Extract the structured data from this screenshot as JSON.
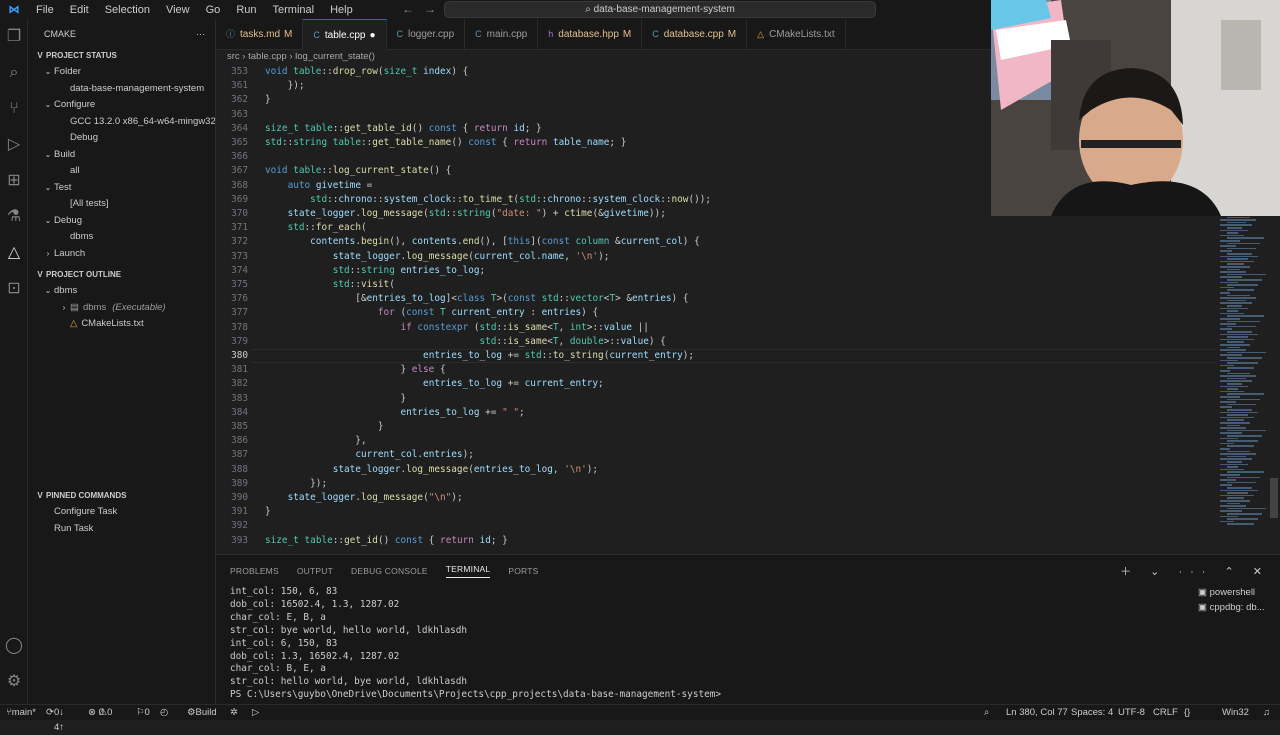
{
  "titlebar": {
    "menu": [
      "File",
      "Edit",
      "Selection",
      "View",
      "Go",
      "Run",
      "Terminal",
      "Help"
    ],
    "search": "data-base-management-system"
  },
  "sidebar": {
    "title": "CMAKE",
    "project_status": "PROJECT STATUS",
    "items": [
      {
        "label": "Folder",
        "indent": 1,
        "chevron": "v"
      },
      {
        "label": "data-base-management-system",
        "indent": 2,
        "chevron": ""
      },
      {
        "label": "Configure",
        "indent": 1,
        "chevron": "v"
      },
      {
        "label": "GCC 13.2.0 x86_64-w64-mingw32...",
        "indent": 2,
        "chevron": ""
      },
      {
        "label": "Debug",
        "indent": 2,
        "chevron": ""
      },
      {
        "label": "Build",
        "indent": 1,
        "chevron": "v"
      },
      {
        "label": "all",
        "indent": 2,
        "chevron": ""
      },
      {
        "label": "Test",
        "indent": 1,
        "chevron": "v"
      },
      {
        "label": "[All tests]",
        "indent": 2,
        "chevron": ""
      },
      {
        "label": "Debug",
        "indent": 1,
        "chevron": "v"
      },
      {
        "label": "dbms",
        "indent": 2,
        "chevron": ""
      },
      {
        "label": "Launch",
        "indent": 1,
        "chevron": ">"
      }
    ],
    "project_outline": "PROJECT OUTLINE",
    "outline": [
      {
        "label": "dbms",
        "indent": 1,
        "chevron": "v",
        "extra": ""
      },
      {
        "label": "dbms",
        "indent": 2,
        "chevron": ">",
        "extra": "(Executable)"
      },
      {
        "label": "CMakeLists.txt",
        "indent": 2,
        "chevron": "",
        "extra": ""
      }
    ],
    "pinned": "PINNED COMMANDS",
    "pinned_items": [
      "Configure Task",
      "Run Task"
    ]
  },
  "tabs": [
    {
      "label": "tasks.md",
      "mod": "M",
      "active": false
    },
    {
      "label": "table.cpp",
      "mod": "●",
      "active": true
    },
    {
      "label": "logger.cpp",
      "mod": "",
      "active": false
    },
    {
      "label": "main.cpp",
      "mod": "",
      "active": false
    },
    {
      "label": "database.hpp",
      "mod": "M",
      "active": false
    },
    {
      "label": "database.cpp",
      "mod": "M",
      "active": false
    },
    {
      "label": "CMakeLists.txt",
      "mod": "",
      "active": false
    }
  ],
  "breadcrumb": [
    "src",
    "table.cpp",
    "log_current_state()"
  ],
  "editor": {
    "current_line": "380",
    "lines": [
      {
        "n": "353",
        "code": "void table::drop_row(size_t index) {"
      },
      {
        "n": "361",
        "code": "    });"
      },
      {
        "n": "362",
        "code": "}"
      },
      {
        "n": "363",
        "code": ""
      },
      {
        "n": "364",
        "code": "size_t table::get_table_id() const { return id; }"
      },
      {
        "n": "365",
        "code": "std::string table::get_table_name() const { return table_name; }"
      },
      {
        "n": "366",
        "code": ""
      },
      {
        "n": "367",
        "code": "void table::log_current_state() {"
      },
      {
        "n": "368",
        "code": "    auto givetime ="
      },
      {
        "n": "369",
        "code": "        std::chrono::system_clock::to_time_t(std::chrono::system_clock::now());"
      },
      {
        "n": "370",
        "code": "    state_logger.log_message(std::string(\"date: \") + ctime(&givetime));"
      },
      {
        "n": "371",
        "code": "    std::for_each("
      },
      {
        "n": "372",
        "code": "        contents.begin(), contents.end(), [this](const column &current_col) {"
      },
      {
        "n": "373",
        "code": "            state_logger.log_message(current_col.name, '\\n');"
      },
      {
        "n": "374",
        "code": "            std::string entries_to_log;"
      },
      {
        "n": "375",
        "code": "            std::visit("
      },
      {
        "n": "376",
        "code": "                [&entries_to_log]<class T>(const std::vector<T> &entries) {"
      },
      {
        "n": "377",
        "code": "                    for (const T current_entry : entries) {"
      },
      {
        "n": "378",
        "code": "                        if constexpr (std::is_same<T, int>::value ||"
      },
      {
        "n": "379",
        "code": "                                      std::is_same<T, double>::value) {"
      },
      {
        "n": "380",
        "code": "                            entries_to_log += std::to_string(current_entry);"
      },
      {
        "n": "381",
        "code": "                        } else {"
      },
      {
        "n": "382",
        "code": "                            entries_to_log += current_entry;"
      },
      {
        "n": "383",
        "code": "                        }"
      },
      {
        "n": "384",
        "code": "                        entries_to_log += \" \";"
      },
      {
        "n": "385",
        "code": "                    }"
      },
      {
        "n": "386",
        "code": "                },"
      },
      {
        "n": "387",
        "code": "                current_col.entries);"
      },
      {
        "n": "388",
        "code": "            state_logger.log_message(entries_to_log, '\\n');"
      },
      {
        "n": "389",
        "code": "        });"
      },
      {
        "n": "390",
        "code": "    state_logger.log_message(\"\\n\");"
      },
      {
        "n": "391",
        "code": "}"
      },
      {
        "n": "392",
        "code": ""
      },
      {
        "n": "393",
        "code": "size_t table::get_id() const { return id; }"
      }
    ]
  },
  "panel": {
    "tabs": [
      "PROBLEMS",
      "OUTPUT",
      "DEBUG CONSOLE",
      "TERMINAL",
      "PORTS"
    ],
    "active_tab": "TERMINAL",
    "terminal_lines": [
      "int_col: 150, 6, 83",
      "dob_col: 16502.4, 1.3, 1287.02",
      "char_col: E, B, a",
      "str_col: bye world, hello world, ldkhlasdh",
      "int_col: 6, 150, 83",
      "dob_col: 1.3, 16502.4, 1287.02",
      "char_col: B, E, a",
      "str_col: hello world, bye world, ldkhlasdh",
      "PS C:\\Users\\guybo\\OneDrive\\Documents\\Projects\\cpp_projects\\data-base-management-system>"
    ],
    "terminals": [
      "powershell",
      "cppdbg: db..."
    ]
  },
  "statusbar": {
    "branch": "main*",
    "sync": "0↓ 4↑",
    "errors": "0",
    "warnings": "0",
    "ports": "0",
    "build": "Build",
    "position": "Ln 380, Col 77",
    "spaces": "Spaces: 4",
    "encoding": "UTF-8",
    "eol": "CRLF",
    "platform": "Win32"
  },
  "colors": {
    "accent": "#0078d4",
    "bg": "#1f1f1f",
    "sidebar": "#181818"
  }
}
